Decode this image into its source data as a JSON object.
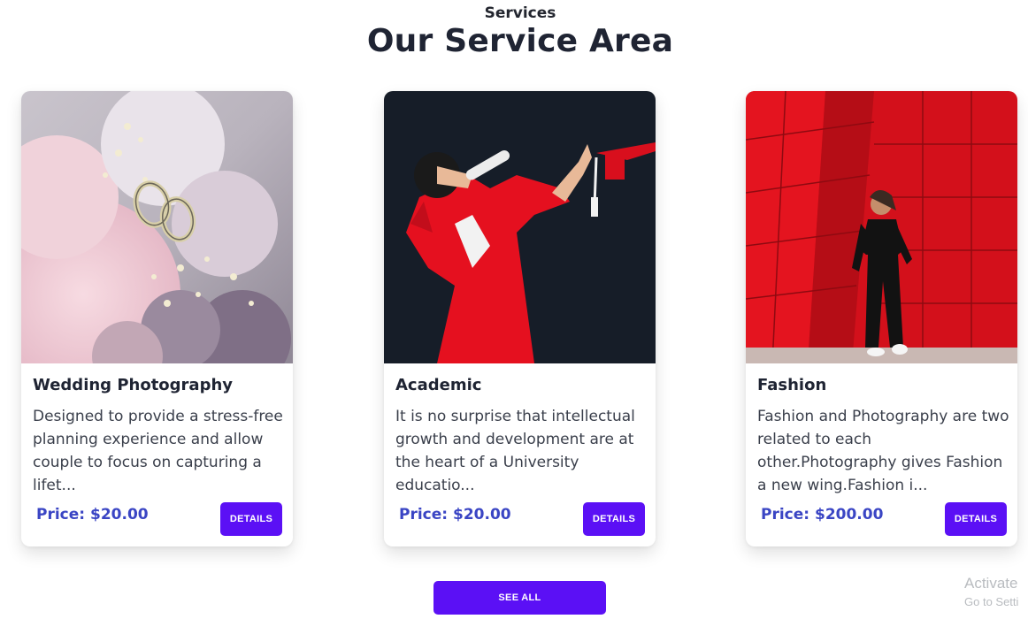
{
  "section": {
    "eyebrow": "Services",
    "title": "Our Service Area"
  },
  "cards": [
    {
      "image_subject": "wedding rings on pink flower bouquet",
      "title": "Wedding Photography",
      "description": "Designed to provide a stress-free planning experience and allow couple to focus on capturing a lifet...",
      "price": "Price: $20.00",
      "button_label": "DETAILS"
    },
    {
      "image_subject": "graduate in red gown throwing cap",
      "title": "Academic",
      "description": "It is no surprise that intellectual growth and development are at the heart of a University educatio...",
      "price": "Price: $20.00",
      "button_label": "DETAILS"
    },
    {
      "image_subject": "woman in black outfit against red wall",
      "title": "Fashion",
      "description": "Fashion and Photography are two related to each other.Photography gives Fashion a new wing.Fashion i...",
      "price": "Price: $200.00",
      "button_label": "DETAILS"
    }
  ],
  "see_all_label": "SEE ALL",
  "watermark": {
    "line1": "Activate",
    "line2": "Go to Setti"
  },
  "colors": {
    "accent": "#5b10f5",
    "price": "#3a45c4",
    "heading": "#1f2433"
  }
}
